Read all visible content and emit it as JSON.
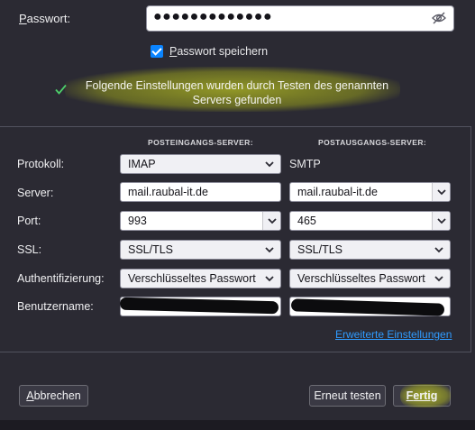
{
  "password": {
    "label_pre": "",
    "label_mnemonic": "P",
    "label_post": "asswort:",
    "value": "●●●●●●●●●●●●●",
    "toggle_icon": "eye-slash-icon"
  },
  "remember": {
    "checked": true,
    "label_mnemonic": "P",
    "label_post": "asswort speichern"
  },
  "status": {
    "icon": "check-icon",
    "color": "#4dcf6a",
    "text": "Folgende Einstellungen wurden durch Testen des genannten Servers gefunden"
  },
  "settings": {
    "incoming_header": "POSTEINGANGS-SERVER:",
    "outgoing_header": "POSTAUSGANGS-SERVER:",
    "rows": {
      "protocol": {
        "label": "Protokoll:",
        "incoming": "IMAP",
        "outgoing": "SMTP"
      },
      "server": {
        "label": "Server:",
        "incoming": "mail.raubal-it.de",
        "outgoing": "mail.raubal-it.de"
      },
      "port": {
        "label": "Port:",
        "incoming": "993",
        "outgoing": "465"
      },
      "ssl": {
        "label": "SSL:",
        "incoming": "SSL/TLS",
        "outgoing": "SSL/TLS"
      },
      "auth": {
        "label": "Authentifizierung:",
        "incoming": "Verschlüsseltes Passwort",
        "outgoing": "Verschlüsseltes Passwort"
      },
      "username": {
        "label": "Benutzername:",
        "incoming": "",
        "outgoing": ""
      }
    },
    "advanced_link": "Erweiterte Einstellungen"
  },
  "buttons": {
    "cancel_mnemonic": "A",
    "cancel_rest": "bbrechen",
    "retest": "Erneut testen",
    "done_mnemonic": "F",
    "done_rest": "ertig"
  },
  "colors": {
    "background": "#2b2a33",
    "accent": "#0a84ff",
    "link": "#2f9bff",
    "highlight": "#d7e11e"
  }
}
